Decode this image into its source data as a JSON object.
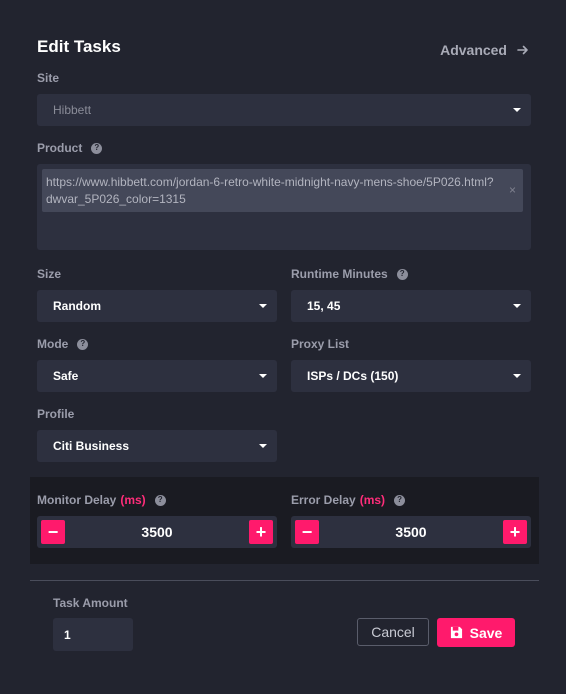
{
  "header": {
    "title": "Edit Tasks",
    "advanced_label": "Advanced"
  },
  "site": {
    "label": "Site",
    "value": "Hibbett"
  },
  "product": {
    "label": "Product",
    "tag": "https://www.hibbett.com/jordan-6-retro-white-midnight-navy-mens-shoe/5P026.html?dwvar_5P026_color=1315",
    "close_glyph": "×"
  },
  "size": {
    "label": "Size",
    "value": "Random"
  },
  "runtime": {
    "label": "Runtime Minutes",
    "value": "15, 45"
  },
  "mode": {
    "label": "Mode",
    "value": "Safe"
  },
  "proxy": {
    "label": "Proxy List",
    "value": "ISPs / DCs (150)"
  },
  "profile": {
    "label": "Profile",
    "value": "Citi Business"
  },
  "monitor_delay": {
    "label": "Monitor Delay",
    "unit": "(ms)",
    "value": "3500"
  },
  "error_delay": {
    "label": "Error Delay",
    "unit": "(ms)",
    "value": "3500"
  },
  "stepper": {
    "minus": "−",
    "plus": "+"
  },
  "help_glyph": "?",
  "task_amount": {
    "label": "Task Amount",
    "value": "1"
  },
  "footer": {
    "cancel_label": "Cancel",
    "save_label": "Save"
  },
  "colors": {
    "accent": "#ff1a6c",
    "background": "#22242f",
    "field": "#2d303f",
    "panel": "#1a1b22"
  }
}
